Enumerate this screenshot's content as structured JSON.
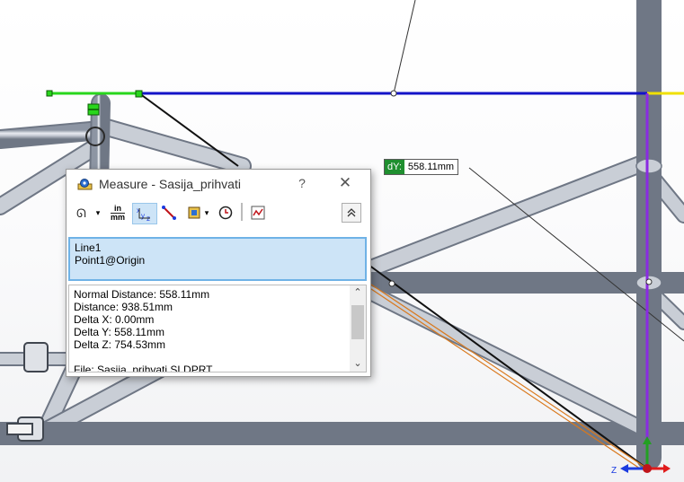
{
  "dialog": {
    "title": "Measure - Sasija_prihvati",
    "help": "?",
    "close": "✕",
    "toolbar": {
      "arc_options": "ᴕ̅ ▾",
      "units_top": "in",
      "units_bottom": "mm",
      "xyz": "ˣᵧ𝓏",
      "point_to_point": "⟍",
      "projection": "▾",
      "history": "⊕",
      "sensor": "⌁",
      "collapse": "ᨈ"
    },
    "selections": [
      "Line1",
      "Point1@Origin"
    ],
    "results": [
      "Normal Distance: 558.11mm",
      "Distance: 938.51mm",
      "Delta X: 0.00mm",
      "Delta Y: 558.11mm",
      "Delta Z: 754.53mm",
      "",
      "File: Sasija_prihvati.SLDPRT"
    ]
  },
  "callout": {
    "tag": "dY:",
    "value": "558.11mm"
  },
  "colors": {
    "tube": "#b9bfca",
    "blue_line": "#1313c8",
    "green_line": "#28d61c",
    "purple_line": "#8a2be2",
    "orange_line": "#d9781c"
  }
}
